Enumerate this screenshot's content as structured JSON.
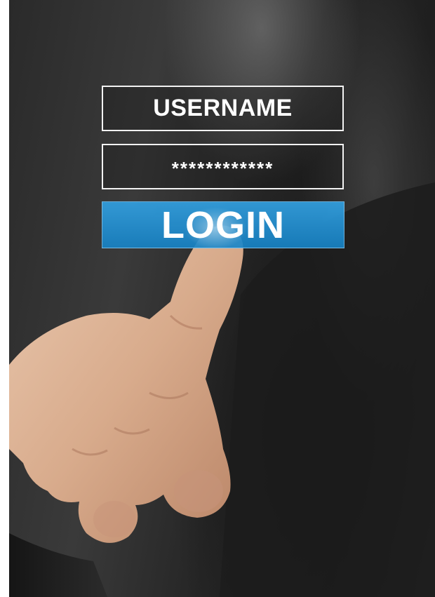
{
  "login_form": {
    "username_text": "USERNAME",
    "password_text": "************",
    "login_label": "LOGIN"
  },
  "colors": {
    "login_button": "#1f8fd0",
    "field_border": "#f2f2f2",
    "background": "#2a2a2a"
  },
  "icons": {
    "hand": "pointing-hand-photo"
  }
}
